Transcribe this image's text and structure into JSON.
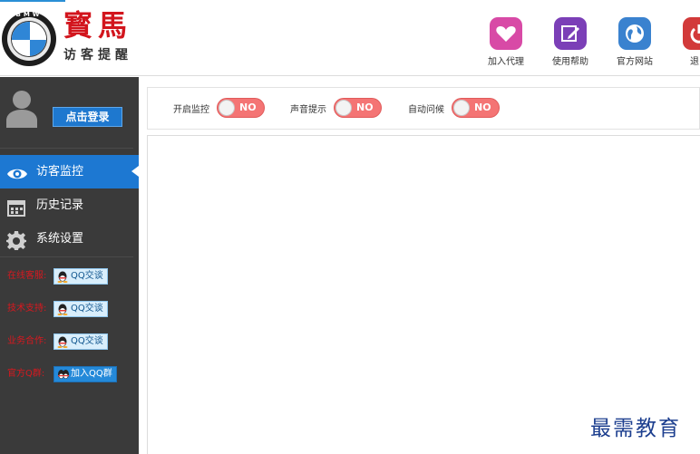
{
  "header": {
    "brand_name": "寳馬",
    "brand_subtitle": "访客提醒",
    "logo_letters": "BMW",
    "tools": [
      {
        "label": "加入代理",
        "icon": "heart-icon",
        "color": "#d84aa6"
      },
      {
        "label": "使用帮助",
        "icon": "edit-icon",
        "color": "#7b3fb7"
      },
      {
        "label": "官方网站",
        "icon": "globe-icon",
        "color": "#3a82cf"
      },
      {
        "label": "退出",
        "icon": "power-icon",
        "color": "#d23a3a"
      }
    ]
  },
  "sidebar": {
    "login_label": "点击登录",
    "menu": [
      {
        "label": "访客监控",
        "icon": "eye-icon",
        "active": true
      },
      {
        "label": "历史记录",
        "icon": "calendar-icon",
        "active": false
      },
      {
        "label": "系统设置",
        "icon": "gear-icon",
        "active": false
      }
    ],
    "contacts": [
      {
        "label": "在线客服:",
        "button": "QQ交谈"
      },
      {
        "label": "技术支持:",
        "button": "QQ交谈"
      },
      {
        "label": "业务合作:",
        "button": "QQ交谈"
      },
      {
        "label": "官方Q群:",
        "button": "加入QQ群"
      }
    ]
  },
  "toolbar": {
    "toggles": [
      {
        "label": "开启监控",
        "state": "NO"
      },
      {
        "label": "声音提示",
        "state": "NO"
      },
      {
        "label": "自动问候",
        "state": "NO"
      }
    ]
  },
  "watermark": "最需教育",
  "colors": {
    "accent": "#1d78d2",
    "sidebar_bg": "#3a3a3a",
    "toggle_off": "#f47474",
    "contact_label": "#d8181f"
  }
}
